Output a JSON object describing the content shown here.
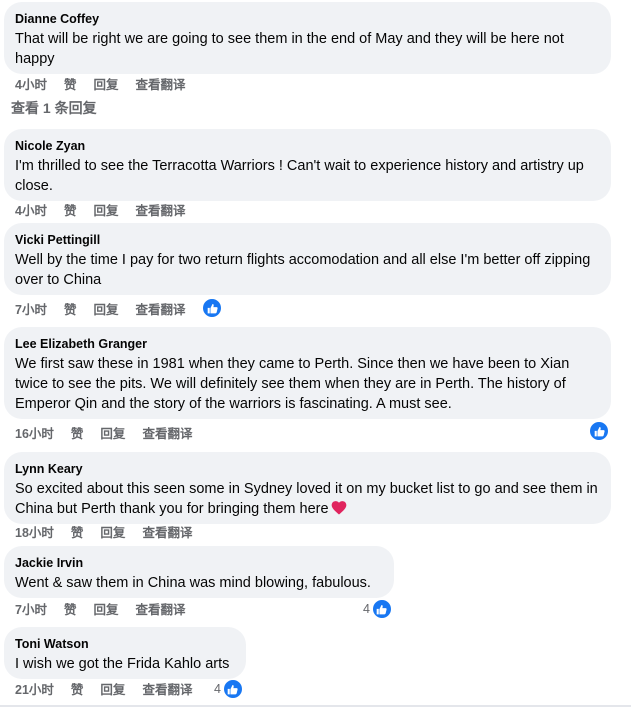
{
  "actions": {
    "like": "赞",
    "reply": "回复",
    "translate": "查看翻译"
  },
  "replies_link": "查看 1 条回复",
  "colors": {
    "bubble": "#f0f2f5",
    "meta_text": "#65676b",
    "like_blue": "#1877f2",
    "heart_red": "#e0245e"
  },
  "comments": [
    {
      "author": "Dianne Coffey",
      "text": "That will be right we are going to see them in the end of May and they will be here not happy",
      "time": "4小时"
    },
    {
      "author": "Nicole Zyan",
      "text": "I'm thrilled to see the Terracotta Warriors ! Can't wait to experience history and artistry up close.",
      "time": "4小时"
    },
    {
      "author": "Vicki Pettingill",
      "text": "Well by the time I pay for two return flights accomodation and all else I'm better off zipping over to China",
      "time": "7小时"
    },
    {
      "author": "Lee Elizabeth Granger",
      "text": "We first saw these in 1981 when they came to Perth. Since then we have been to Xian twice to see the pits. We will definitely see them when they are in Perth. The history of Emperor Qin and the story of the warriors is fascinating. A must see.",
      "time": "16小时"
    },
    {
      "author": "Lynn Keary",
      "text": "So excited about this seen some in Sydney loved it on my bucket list to go and see them in China but Perth thank you for bringing them here",
      "time": "18小时"
    },
    {
      "author": "Jackie Irvin",
      "text": "Went & saw them in China was mind blowing, fabulous.",
      "time": "7小时",
      "reaction_count": "4"
    },
    {
      "author": "Toni Watson",
      "text": "I wish we got the Frida Kahlo arts",
      "time": "21小时",
      "reaction_count": "4"
    }
  ]
}
